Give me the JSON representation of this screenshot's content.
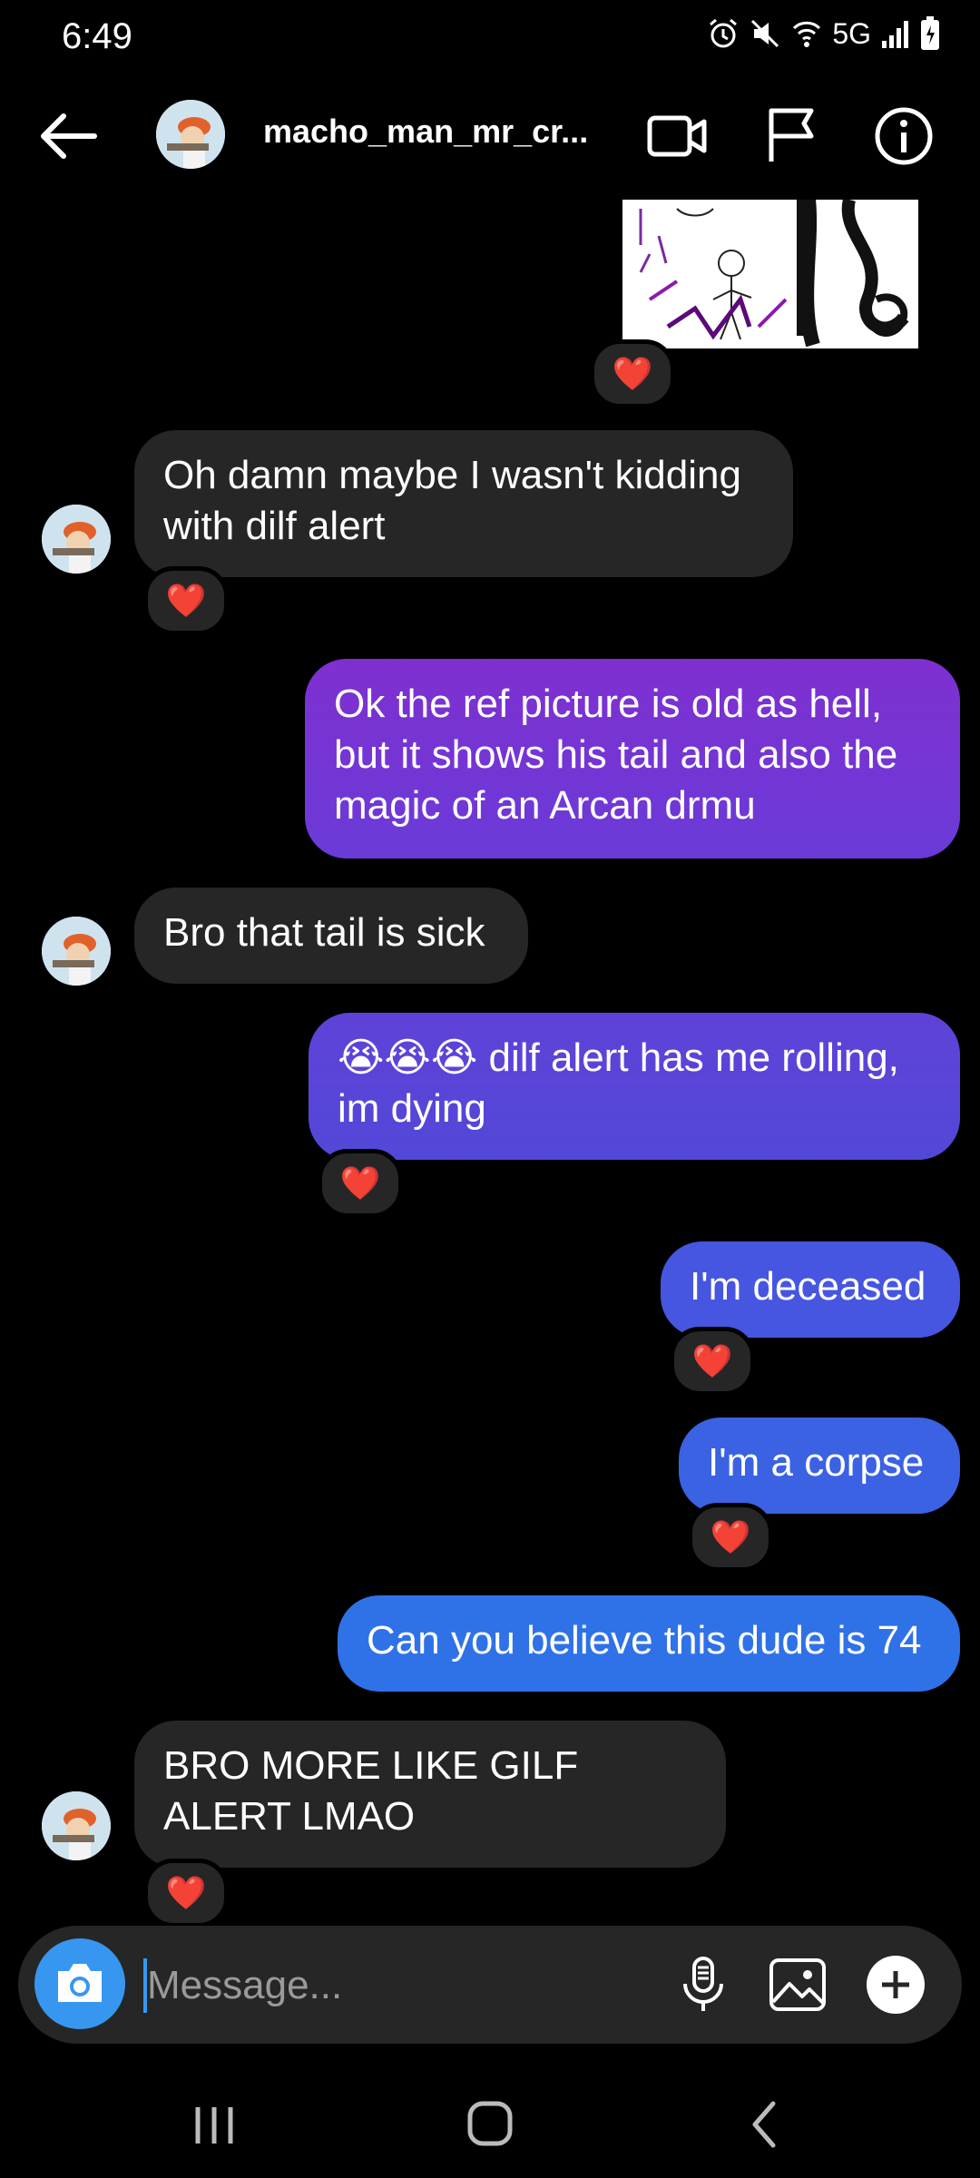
{
  "status": {
    "time": "6:49",
    "network": "5G"
  },
  "header": {
    "username": "macho_man_mr_cr..."
  },
  "messages": {
    "m1": "Oh damn maybe I wasn't kidding with dilf alert",
    "m2": "Ok the ref picture is old as hell, but it shows his tail and also the magic of an Arcan drmu",
    "m3": "Bro that tail is sick",
    "m4_emoji": "😭😭😭",
    "m4": "dilf alert has me rolling, im dying",
    "m5": "I'm deceased",
    "m6": "I'm a corpse",
    "m7": "Can you believe this dude is 74",
    "m8": "BRO MORE LIKE GILF ALERT LMAO"
  },
  "reaction": "❤️",
  "composer": {
    "placeholder": "Message..."
  },
  "colors": {
    "accent": "#3797f0",
    "incoming": "#262626",
    "out_purple": "#7b30d0",
    "out_violet": "#5a45d8",
    "out_blue": "#3a63e0",
    "out_lightblue": "#2f72e8"
  },
  "icons": [
    "back-arrow-icon",
    "video-call-icon",
    "flag-icon",
    "info-icon",
    "camera-icon",
    "microphone-icon",
    "gallery-icon",
    "plus-icon",
    "recents-icon",
    "home-icon",
    "back-nav-icon"
  ]
}
